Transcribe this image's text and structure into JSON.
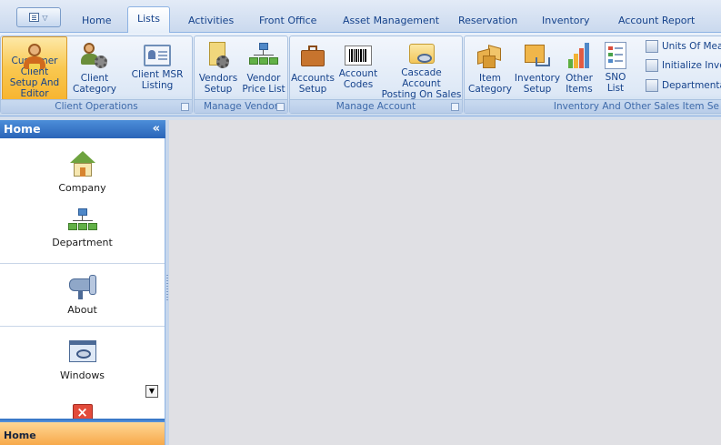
{
  "tabs": [
    {
      "label": "Home",
      "active": false
    },
    {
      "label": "Lists",
      "active": true
    },
    {
      "label": "Activities",
      "active": false
    },
    {
      "label": "Front Office",
      "active": false
    },
    {
      "label": "Asset Management",
      "active": false
    },
    {
      "label": "Reservation",
      "active": false
    },
    {
      "label": "Inventory",
      "active": false
    },
    {
      "label": "Account Report",
      "active": false
    }
  ],
  "ribbon": {
    "groups": [
      {
        "caption": "Client Operations",
        "buttons": [
          {
            "label": "Customer Client\nSetup And Editor",
            "icon": "customer-client-icon",
            "selected": true
          },
          {
            "label": "Client\nCategory",
            "icon": "client-category-icon"
          },
          {
            "label": "Client MSR\nListing",
            "icon": "id-card-icon"
          }
        ]
      },
      {
        "caption": "Manage Vendor",
        "buttons": [
          {
            "label": "Vendors\nSetup",
            "icon": "vendor-setup-icon"
          },
          {
            "label": "Vendor\nPrice List",
            "icon": "hierarchy-icon"
          }
        ]
      },
      {
        "caption": "Manage Account",
        "buttons": [
          {
            "label": "Accounts\nSetup",
            "icon": "briefcase-icon"
          },
          {
            "label": "Account\nCodes",
            "icon": "barcode-icon"
          },
          {
            "label": "Cascade Account\nPosting On Sales",
            "icon": "eye-screen-icon"
          }
        ]
      },
      {
        "caption": "Inventory And Other Sales Item Se",
        "buttons": [
          {
            "label": "Item\nCategory",
            "icon": "cubes-icon"
          },
          {
            "label": "Inventory\nSetup",
            "icon": "cart-box-icon"
          },
          {
            "label": "Other\nItems",
            "icon": "bar-chart-icon"
          },
          {
            "label": "SNO\nList",
            "icon": "list-icon"
          }
        ],
        "small_items": [
          {
            "label": "Units Of Mea",
            "icon": "units-icon"
          },
          {
            "label": "Initialize Inve",
            "icon": "initialize-icon"
          },
          {
            "label": "Departmenta",
            "icon": "department-icon"
          }
        ]
      }
    ]
  },
  "panel": {
    "title": "Home",
    "collapse_glyph": "«",
    "items": [
      {
        "label": "Company",
        "icon": "house-icon"
      },
      {
        "label": "Department",
        "icon": "org-chart-icon"
      },
      {
        "label": "About",
        "icon": "megaphone-icon"
      },
      {
        "label": "Windows",
        "icon": "window-eye-icon"
      }
    ],
    "footer": "Home",
    "scroll_glyph": "▼"
  },
  "colors": {
    "accent": "#2a64b8",
    "selected": "#f9c850",
    "footer": "#f7a94b",
    "workspace": "#e0e0e4"
  }
}
